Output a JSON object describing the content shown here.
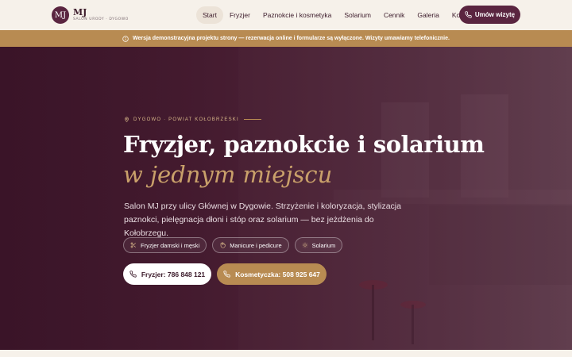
{
  "logo": {
    "initials": "MJ",
    "name": "MJ",
    "tagline": "SALON URODY · DYGOWO"
  },
  "nav": {
    "items": [
      {
        "label": "Start",
        "active": true
      },
      {
        "label": "Fryzjer"
      },
      {
        "label": "Paznokcie i kosmetyka"
      },
      {
        "label": "Solarium"
      },
      {
        "label": "Cennik"
      },
      {
        "label": "Galeria"
      },
      {
        "label": "Kontakt"
      }
    ],
    "cta_label": "Umów wizytę"
  },
  "notice": {
    "text": "Wersja demonstracyjna projektu strony — rezerwacja online i formularze są wyłączone. Wizyty umawiamy telefonicznie."
  },
  "hero": {
    "location": "DYGOWO · POWIAT KOŁOBRZESKI",
    "title_line1": "Fryzjer, paznokcie i solarium",
    "title_line2": "w jednym miejscu",
    "description": "Salon MJ przy ulicy Głównej w Dygowie. Strzyżenie i koloryzacja, stylizacja paznokci, pielęgnacja dłoni i stóp oraz solarium — bez jeżdżenia do Kołobrzegu.",
    "chips": [
      {
        "label": "Fryzjer damski i męski",
        "icon": "scissors-icon"
      },
      {
        "label": "Manicure i pedicure",
        "icon": "hand-icon"
      },
      {
        "label": "Solarium",
        "icon": "sun-icon"
      }
    ],
    "buttons": {
      "phone_hairdresser": "Fryzjer: 786 848 121",
      "phone_beautician": "Kosmetyczka: 508 925 647"
    }
  },
  "colors": {
    "brand": "#5a2540",
    "accent": "#b88b52",
    "cream": "#f6f1ea"
  }
}
